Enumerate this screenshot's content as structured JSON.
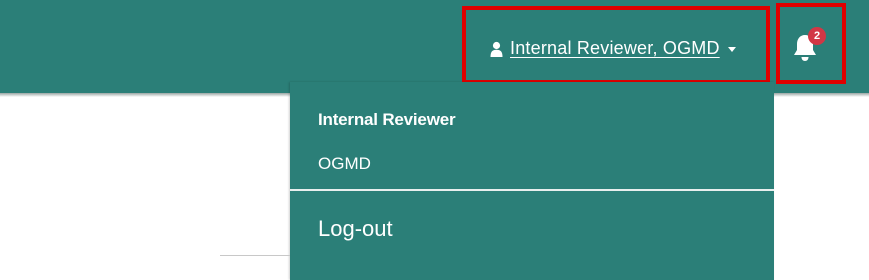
{
  "header": {
    "user_menu": {
      "label": " Internal Reviewer, OGMD ",
      "icon": "user-icon",
      "caret_icon": "caret-down-icon"
    },
    "notifications": {
      "icon": "bell-icon",
      "badge_count": "2"
    }
  },
  "dropdown": {
    "role": "Internal Reviewer",
    "organization": "OGMD",
    "logout_label": "Log-out"
  },
  "colors": {
    "header_bg": "#2b7f78",
    "badge_bg": "#d23745",
    "highlight": "#e00000"
  }
}
